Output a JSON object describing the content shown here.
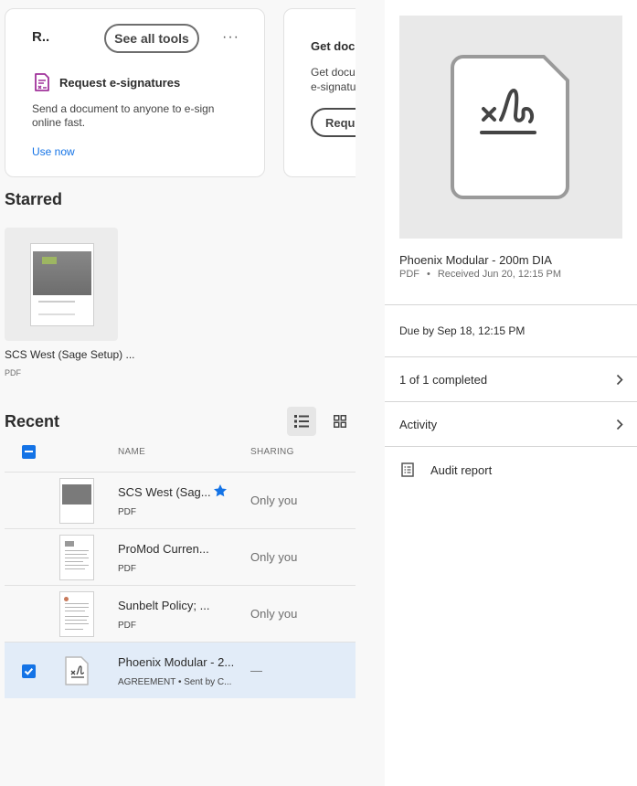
{
  "tools_card": {
    "title": "R..",
    "see_all_label": "See all tools",
    "more_label": "···",
    "tool_name": "Request e-signatures",
    "tool_desc": "Send a document to anyone to e-sign online fast.",
    "use_now_label": "Use now"
  },
  "promo_card": {
    "title": "Get docu",
    "desc_line1": "Get docu",
    "desc_line2": "e-signatu",
    "button_label": "Reque"
  },
  "starred": {
    "heading": "Starred",
    "items": [
      {
        "name": "SCS West (Sage Setup) ...",
        "type": "PDF"
      }
    ]
  },
  "recent": {
    "heading": "Recent",
    "columns": {
      "name": "NAME",
      "sharing": "SHARING"
    },
    "rows": [
      {
        "name": "SCS West (Sag...",
        "type": "PDF",
        "sharing": "Only you",
        "starred": true,
        "selected": false
      },
      {
        "name": "ProMod Curren...",
        "type": "PDF",
        "sharing": "Only you",
        "starred": false,
        "selected": false
      },
      {
        "name": "Sunbelt Policy; ...",
        "type": "PDF",
        "sharing": "Only you",
        "starred": false,
        "selected": false
      },
      {
        "name": "Phoenix Modular - 2...",
        "type": "AGREEMENT  •  Sent by C...",
        "sharing": "—",
        "starred": false,
        "selected": true
      }
    ]
  },
  "details": {
    "title": "Phoenix Modular - 200m DIA",
    "file_type": "PDF",
    "separator": "•",
    "received": "Received Jun 20, 12:15 PM",
    "due": "Due by Sep 18, 12:15 PM",
    "completed": "1 of 1 completed",
    "activity": "Activity",
    "audit": "Audit report"
  },
  "colors": {
    "accent": "#1473e6",
    "esign_purple": "#a0329b",
    "selected_row": "#e2ecf8"
  }
}
